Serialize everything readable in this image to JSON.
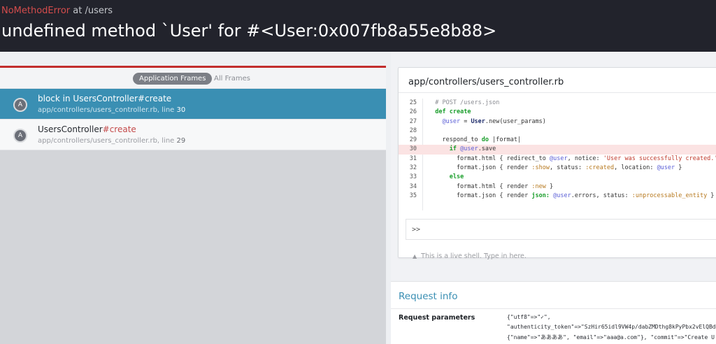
{
  "header": {
    "error_class": "NoMethodError",
    "at_text": "at /users",
    "message": "undefined method `User' for #<User:0x007fb8a55e8b88>"
  },
  "frames_tabs": {
    "application": "Application Frames",
    "all": "All Frames"
  },
  "frames": [
    {
      "avatar": "A",
      "name": "block in UsersController",
      "method": "#create",
      "path": "app/controllers/users_controller.rb, line ",
      "line": "30"
    },
    {
      "avatar": "A",
      "name": "UsersController",
      "method": "#create",
      "path": "app/controllers/users_controller.rb, line ",
      "line": "29"
    }
  ],
  "source": {
    "file": "app/controllers/users_controller.rb",
    "line_numbers": [
      "25",
      "26",
      "27",
      "28",
      "29",
      "30",
      "31",
      "32",
      "33",
      "34",
      "35"
    ],
    "highlight_line": "30",
    "shell_prompt": ">>",
    "shell_hint": "This is a live shell. Type in here."
  },
  "request": {
    "heading": "Request info",
    "param_label": "Request parameters",
    "param_lines": [
      "{\"utf8\"=>\"✓\",",
      "\"authenticity_token\"=>\"SzHir65idl9VW4p/dabZMDthg8kPyPbx2vElQBdf",
      "{\"name\"=>\"ああああ\", \"email\"=>\"aaa@a.com\"}, \"commit\"=>\"Create U"
    ]
  }
}
